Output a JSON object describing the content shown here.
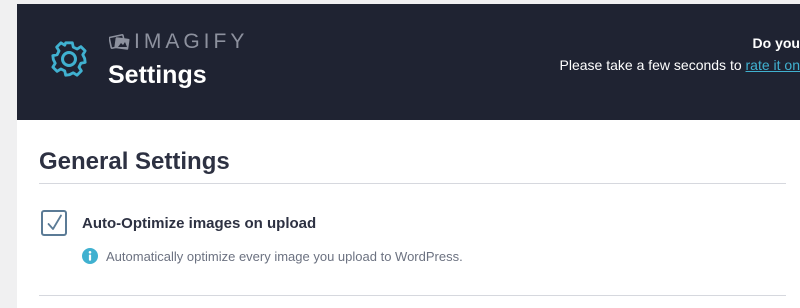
{
  "header": {
    "brand": "IMAGIFY",
    "title": "Settings",
    "rate_prompt_line1": "Do you",
    "rate_prompt_line2": "Please take a few seconds to ",
    "rate_link": "rate it on"
  },
  "general": {
    "title": "General Settings",
    "auto_optimize": {
      "label": "Auto-Optimize images on upload",
      "checked": true,
      "help": "Automatically optimize every image you upload to WordPress."
    }
  },
  "colors": {
    "header_bg": "#1f2332",
    "accent": "#40b1d0",
    "brand_gray": "#8d919e",
    "checkbox_border": "#5b7b96"
  },
  "icons": {
    "header_icon": "gear-icon",
    "brand_mark": "imagify-logo-icon",
    "checkbox_mark": "checkmark-icon",
    "help_icon": "info-icon"
  }
}
